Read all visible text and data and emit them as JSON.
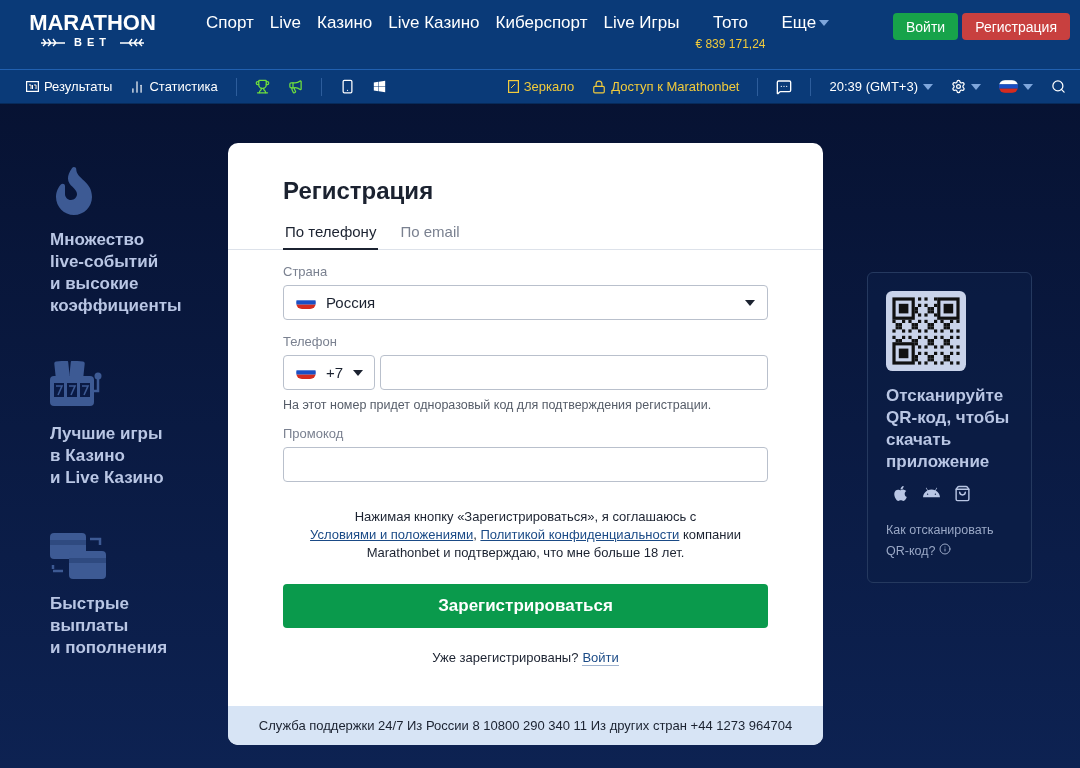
{
  "logo": {
    "name": "MARATHON",
    "sub": "BET"
  },
  "nav": [
    {
      "label": "Спорт"
    },
    {
      "label": "Live"
    },
    {
      "label": "Казино"
    },
    {
      "label": "Live Казино"
    },
    {
      "label": "Киберспорт"
    },
    {
      "label": "Live Игры"
    },
    {
      "label": "Тото",
      "note": "€ 839 171,24"
    },
    {
      "label": "Еще",
      "dropdown": true
    }
  ],
  "auth": {
    "login": "Войти",
    "register": "Регистрация"
  },
  "toolbar": {
    "results": "Результаты",
    "stats": "Статистика",
    "mirror": "Зеркало",
    "access": "Доступ к Marathonbet",
    "time": "20:39 (GMT+3)"
  },
  "features": [
    {
      "kind": "fire",
      "text": "Множество\nlive-событий\nи высокие\nкоэффициенты"
    },
    {
      "kind": "slots",
      "text": "Лучшие игры\nв Казино\nи Live Казино"
    },
    {
      "kind": "cards",
      "text": "Быстрые\nвыплаты\nи пополнения"
    }
  ],
  "form": {
    "title": "Регистрация",
    "tabs": [
      {
        "label": "По телефону",
        "selected": true
      },
      {
        "label": "По email",
        "selected": false
      }
    ],
    "country": {
      "label": "Страна",
      "value": "Россия"
    },
    "phone": {
      "label": "Телефон",
      "code": "+7",
      "hint": "На этот номер придет одноразовый код для подтверждения регистрации."
    },
    "promo": {
      "label": "Промокод"
    },
    "agreement": {
      "before": "Нажимая кнопку «Зарегистрироваться», я соглашаюсь с",
      "link1": "Условиями и положениями",
      "sep": ",",
      "link2": "Политикой конфиденциальности",
      "after": "компании Marathonbet и подтверждаю, что мне больше 18 лет."
    },
    "submit": "Зарегистрироваться",
    "already": {
      "text": "Уже зарегистрированы?",
      "link": "Войти"
    },
    "support": "Служба поддержки 24/7 Из России 8 10800 290 340 11 Из других стран +44 1273 964704"
  },
  "qr": {
    "title": "Отсканируйте\nQR-код, чтобы\nскачать\nприложение",
    "help": "Как отсканировать\nQR-код?"
  }
}
